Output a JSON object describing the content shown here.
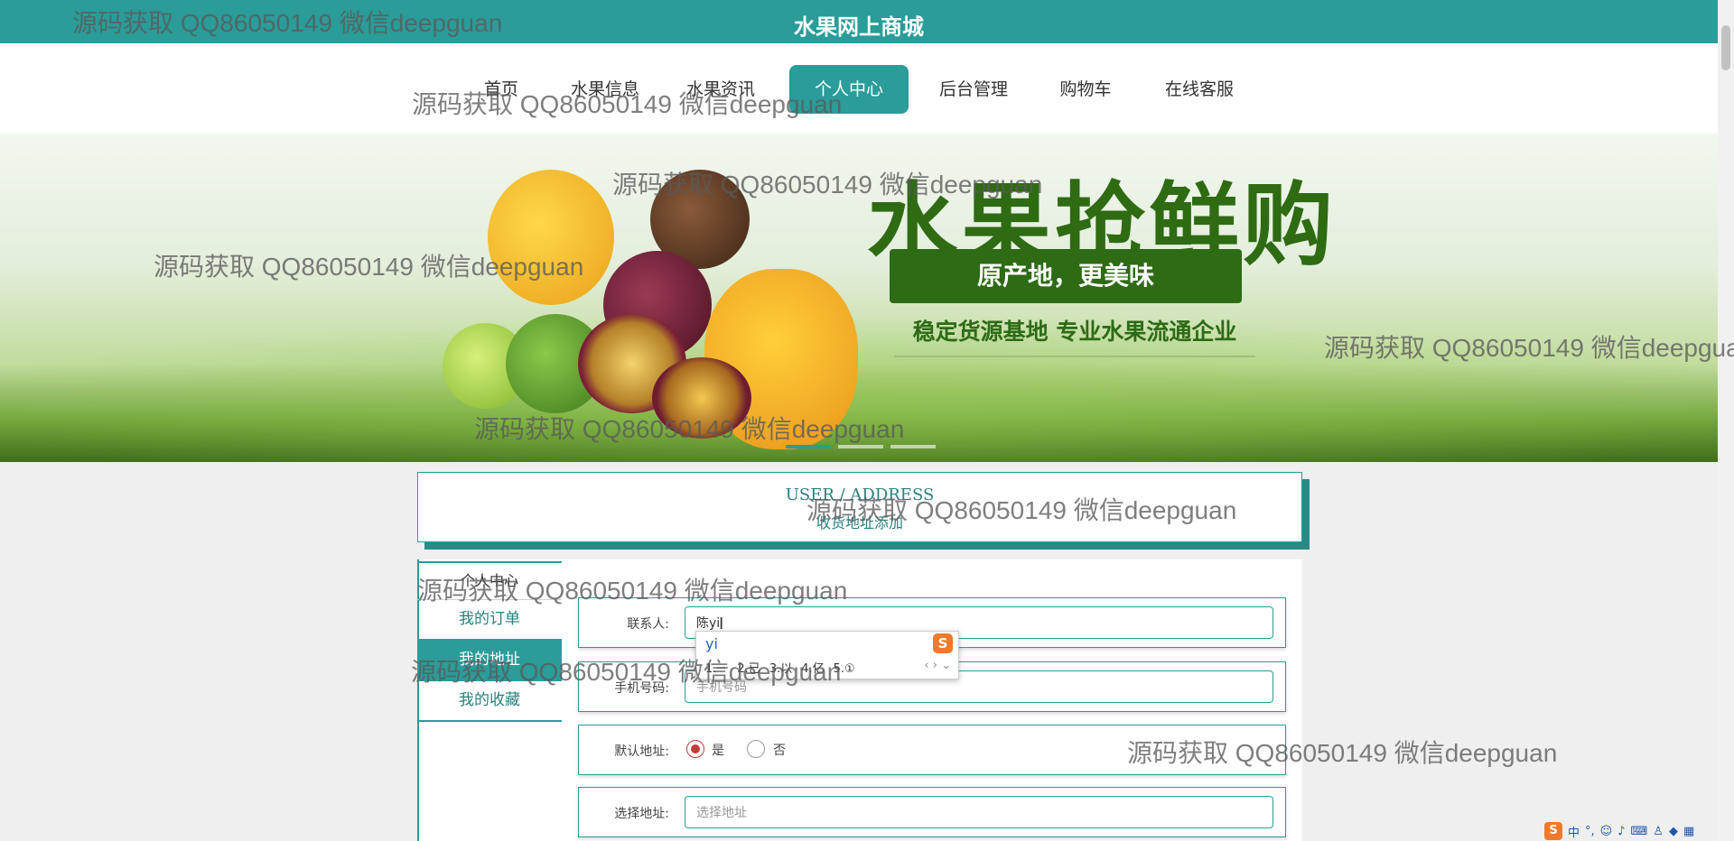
{
  "site": {
    "title": "水果网上商城"
  },
  "nav": [
    {
      "label": "首页"
    },
    {
      "label": "水果信息"
    },
    {
      "label": "水果资讯"
    },
    {
      "label": "个人中心"
    },
    {
      "label": "后台管理"
    },
    {
      "label": "购物车"
    },
    {
      "label": "在线客服"
    }
  ],
  "banner": {
    "title": "水果抢鲜购",
    "subtitle1": "原产地，更美味",
    "subtitle2": "稳定货源基地 专业水果流通企业"
  },
  "section": {
    "heading_en": "USER / ADDRESS",
    "heading_cn": "收货地址添加"
  },
  "side_menu": {
    "title": "个人中心",
    "items": [
      {
        "label": "我的订单"
      },
      {
        "label": "我的地址"
      },
      {
        "label": "我的收藏"
      }
    ]
  },
  "form": {
    "contact": {
      "label": "联系人:",
      "value": "陈yi"
    },
    "phone": {
      "label": "手机号码:",
      "placeholder": "手机号码"
    },
    "default": {
      "label": "默认地址:",
      "yes": "是",
      "no": "否",
      "selected": "是"
    },
    "address": {
      "label": "选择地址:",
      "placeholder": "选择地址"
    }
  },
  "ime": {
    "composition": "yi",
    "candidates": [
      "1.一",
      "2.已",
      "3.以",
      "4.亿",
      "5.①"
    ]
  },
  "tray": {
    "lang": "中"
  },
  "watermark": "源码获取 QQ86050149 微信deepguan",
  "colors": {
    "accent": "#2a9c99",
    "radio": "#c53b3b",
    "banner_green": "#2e6b12"
  }
}
